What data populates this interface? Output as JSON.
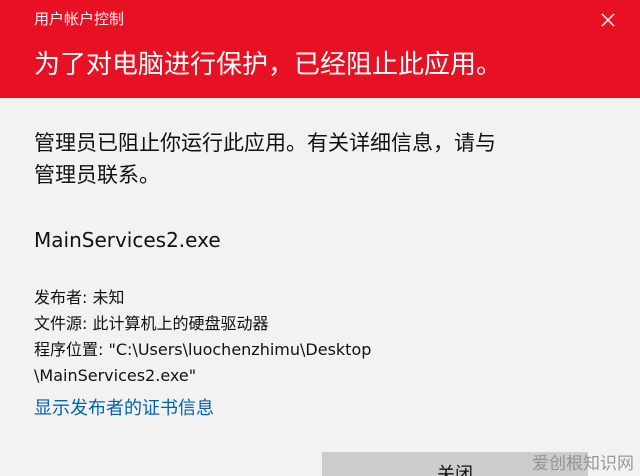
{
  "window": {
    "title": "用户帐户控制",
    "close_icon": "close-icon"
  },
  "header": {
    "message": "为了对电脑进行保护，已经阻止此应用。"
  },
  "body": {
    "message": "管理员已阻止你运行此应用。有关详细信息，请与管理员联系。",
    "app_name": "MainServices2.exe",
    "publisher_label": "发布者:",
    "publisher_value": "未知",
    "source_label": "文件源:",
    "source_value": "此计算机上的硬盘驱动器",
    "location_label": "程序位置:",
    "location_line1": "\"C:\\Users\\luochenzhimu\\Desktop",
    "location_line2": "\\MainServices2.exe\"",
    "cert_link": "显示发布者的证书信息"
  },
  "actions": {
    "close_label": "关闭"
  },
  "watermark": "爱创根知识网",
  "colors": {
    "header_bg": "#e81123",
    "link": "#0063b1",
    "button_bg": "#cccccc"
  }
}
